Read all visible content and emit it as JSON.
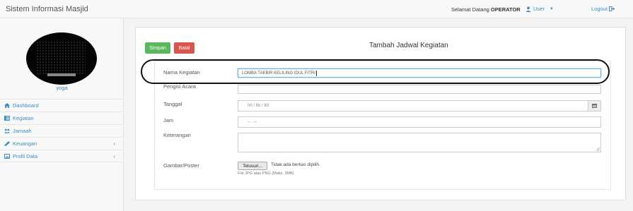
{
  "app": {
    "title": "Sistem Informasi Masjid"
  },
  "header": {
    "welcome_prefix": "Selamat Datang",
    "welcome_role": "OPERATOR",
    "user_label": "User",
    "logout_label": "Logout"
  },
  "sidebar": {
    "username": "yoga",
    "items": [
      {
        "label": "Dashboard",
        "icon": "home-icon",
        "has_submenu": false
      },
      {
        "label": "Kegiatan",
        "icon": "list-icon",
        "has_submenu": false
      },
      {
        "label": "Jamaah",
        "icon": "users-icon",
        "has_submenu": false
      },
      {
        "label": "Keuangan",
        "icon": "money-icon",
        "has_submenu": true
      },
      {
        "label": "Profil Data",
        "icon": "profile-icon",
        "has_submenu": true
      }
    ]
  },
  "panel": {
    "title": "Tambah Jadwal Kegiatan",
    "save_label": "Simpan",
    "cancel_label": "Batal"
  },
  "form": {
    "nama_kegiatan": {
      "label": "Nama Kegiatan",
      "value": "LOMBA TAKBIR KELILING IDUL FITRI"
    },
    "pengisi_acara": {
      "label": "Pengisi Acara",
      "value": ""
    },
    "tanggal": {
      "label": "Tanggal",
      "placeholder": "hh / bb / tttt"
    },
    "jam": {
      "label": "Jam",
      "placeholder": "-- . --"
    },
    "keterangan": {
      "label": "Keterangan",
      "value": ""
    },
    "gambar": {
      "label": "Gambar/Poster",
      "button_label": "Telusuri...",
      "status": "Tidak ada berkas dipilih.",
      "help": "File JPG atau PNG (Maks. 3MB)"
    }
  },
  "colors": {
    "accent": "#3c8dbc",
    "save": "#5cb85c",
    "cancel": "#d9534f",
    "annotation": "#111111"
  }
}
